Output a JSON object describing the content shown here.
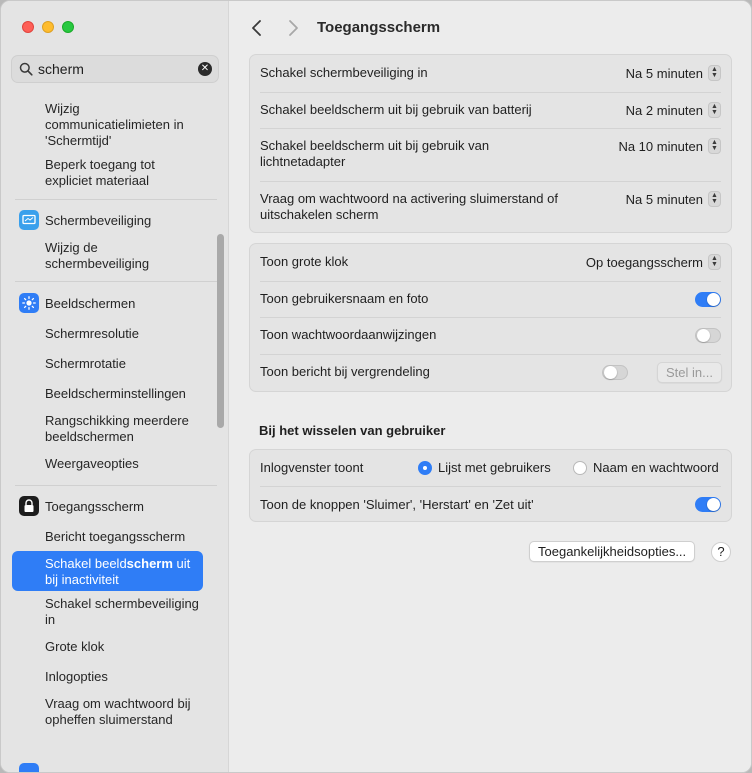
{
  "colors": {
    "accent": "#2f7df6",
    "sidebar_bg": "#e4e4e4",
    "content_bg": "#ececec"
  },
  "search": {
    "value": "scherm",
    "icon": "search-icon",
    "clear_icon": "clear-icon"
  },
  "sidebar": {
    "items": [
      {
        "label": "Wijzig communicatielimieten in 'Schermtijd'"
      },
      {
        "label": "Beperk toegang tot expliciet materiaal"
      },
      {
        "label": "Schermbeveiliging",
        "icon": "screensaver-icon"
      },
      {
        "label": "Wijzig de schermbeveiliging"
      },
      {
        "label": "Beeldschermen",
        "icon": "displays-icon"
      },
      {
        "label": "Schermresolutie"
      },
      {
        "label": "Schermrotatie"
      },
      {
        "label": "Beeldscherminstellingen"
      },
      {
        "label": "Rangschikking meerdere beeldschermen"
      },
      {
        "label": "Weergaveopties"
      },
      {
        "label": "Toegangsscherm",
        "icon": "lock-icon"
      },
      {
        "label": "Bericht toegangsscherm"
      },
      {
        "label_before": "Schakel beeld",
        "label_match": "scherm",
        "label_after": " uit bij inactiviteit"
      },
      {
        "label": "Schakel schermbeveiliging in"
      },
      {
        "label": "Grote klok"
      },
      {
        "label": "Inlogopties"
      },
      {
        "label": "Vraag om wachtwoord bij opheffen sluimerstand"
      }
    ]
  },
  "main": {
    "title": "Toegangsscherm",
    "group1": [
      {
        "label": "Schakel schermbeveiliging in",
        "value": "Na 5 minuten"
      },
      {
        "label": "Schakel beeldscherm uit bij gebruik van batterij",
        "value": "Na 2 minuten"
      },
      {
        "label": "Schakel beeldscherm uit bij gebruik van lichtnetadapter",
        "value": "Na 10 minuten"
      },
      {
        "label": "Vraag om wachtwoord na activering sluimerstand of uitschakelen scherm",
        "value": "Na 5 minuten"
      }
    ],
    "group2": [
      {
        "label": "Toon grote klok",
        "value": "Op toegangsscherm"
      },
      {
        "label": "Toon gebruikersnaam en foto",
        "toggle": true
      },
      {
        "label": "Toon wachtwoordaanwijzingen",
        "toggle": false
      },
      {
        "label": "Toon bericht bij vergrendeling",
        "toggle": false,
        "button": "Stel in..."
      }
    ],
    "section_title": "Bij het wisselen van gebruiker",
    "group3": {
      "login_label": "Inlogvenster toont",
      "radio_options": [
        "Lijst met gebruikers",
        "Naam en wachtwoord"
      ],
      "radio_selected": "Lijst met gebruikers",
      "buttons_label": "Toon de knoppen 'Sluimer', 'Herstart' en 'Zet uit'",
      "buttons_toggle": true
    },
    "accessibility_button": "Toegankelijkheidsopties...",
    "help_label": "?"
  }
}
